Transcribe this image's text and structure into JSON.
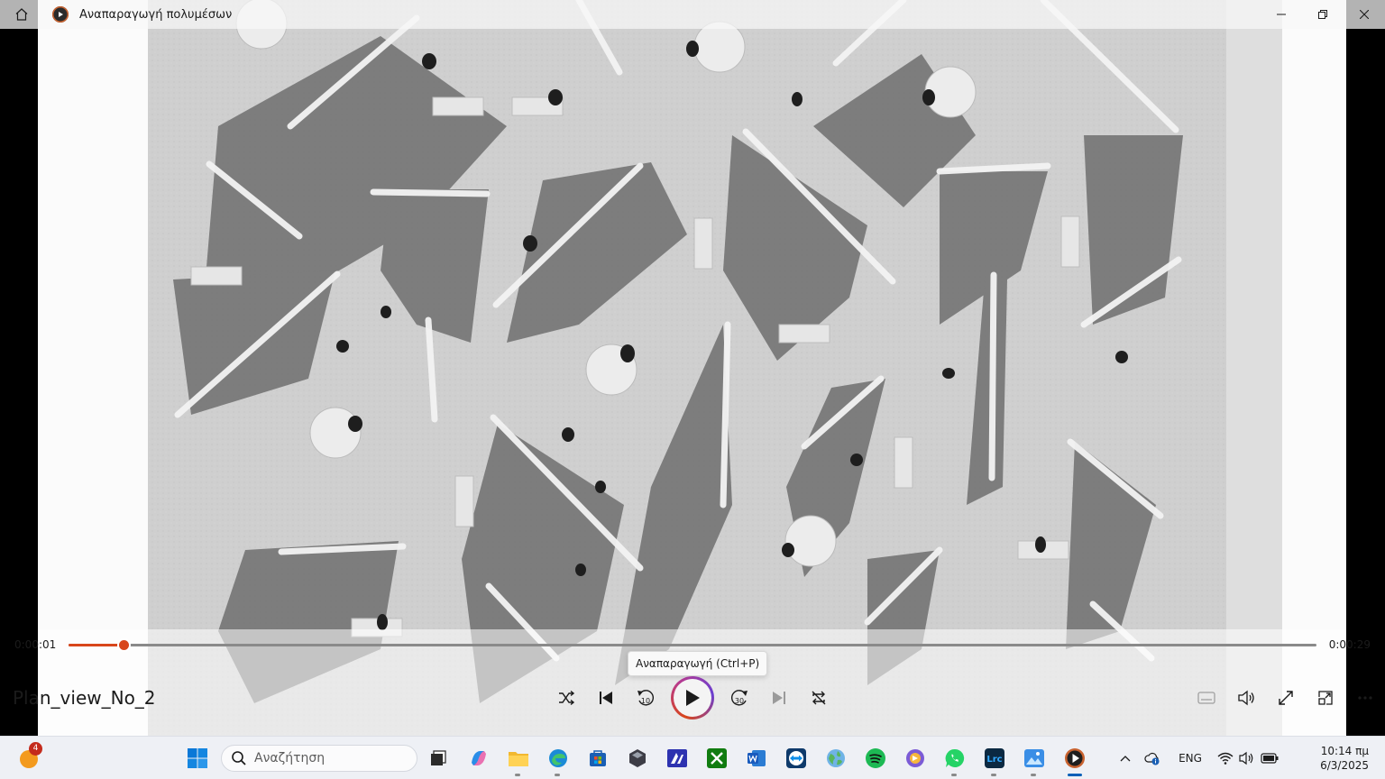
{
  "window": {
    "title": "Αναπαραγωγή πολυμέσων"
  },
  "player": {
    "media_title": "Plan_view_No_2",
    "time_current": "0:00:01",
    "time_total": "0:00:29",
    "progress_fraction": 0.044,
    "tooltip": "Αναπαραγωγή (Ctrl+P)",
    "accent_color": "#d8461b",
    "controls": [
      "shuffle-icon",
      "previous-icon",
      "rewind-10-icon",
      "play-icon",
      "forward-30-icon",
      "next-icon",
      "repeat-icon"
    ],
    "rewind_label": "10",
    "forward_label": "30",
    "right_tools": [
      "subtitles-icon",
      "volume-icon",
      "fullscreen-icon",
      "miniplayer-icon",
      "more-icon"
    ]
  },
  "taskbar": {
    "weather_badge": "4",
    "search_placeholder": "Αναζήτηση",
    "apps": [
      "task-view",
      "copilot",
      "file-explorer",
      "edge",
      "microsoft-store",
      "wireframe-app",
      "design-app",
      "xbox",
      "word",
      "teamviewer",
      "globe-app",
      "spotify",
      "location-app",
      "whatsapp",
      "lightroom",
      "photos",
      "media-player"
    ],
    "active_app": "media-player",
    "lightroom_label": "Lrc",
    "language": "ENG",
    "time": "10:14 πμ",
    "date": "6/3/2025"
  }
}
